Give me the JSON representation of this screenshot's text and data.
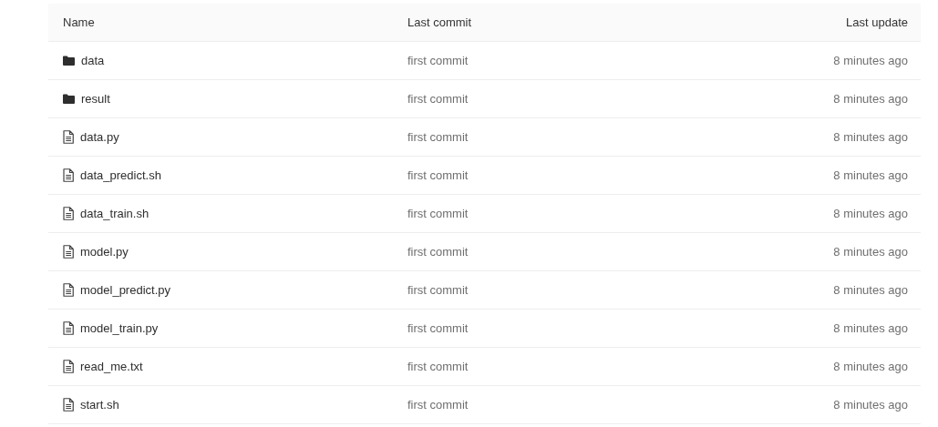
{
  "table": {
    "columns": [
      "Name",
      "Last commit",
      "Last update"
    ],
    "rows": [
      {
        "kind": "folder",
        "name": "data",
        "commit": "first commit",
        "updated": "8 minutes ago"
      },
      {
        "kind": "folder",
        "name": "result",
        "commit": "first commit",
        "updated": "8 minutes ago"
      },
      {
        "kind": "file",
        "name": "data.py",
        "commit": "first commit",
        "updated": "8 minutes ago"
      },
      {
        "kind": "file",
        "name": "data_predict.sh",
        "commit": "first commit",
        "updated": "8 minutes ago"
      },
      {
        "kind": "file",
        "name": "data_train.sh",
        "commit": "first commit",
        "updated": "8 minutes ago"
      },
      {
        "kind": "file",
        "name": "model.py",
        "commit": "first commit",
        "updated": "8 minutes ago"
      },
      {
        "kind": "file",
        "name": "model_predict.py",
        "commit": "first commit",
        "updated": "8 minutes ago"
      },
      {
        "kind": "file",
        "name": "model_train.py",
        "commit": "first commit",
        "updated": "8 minutes ago"
      },
      {
        "kind": "file",
        "name": "read_me.txt",
        "commit": "first commit",
        "updated": "8 minutes ago"
      },
      {
        "kind": "file",
        "name": "start.sh",
        "commit": "first commit",
        "updated": "8 minutes ago"
      }
    ]
  }
}
